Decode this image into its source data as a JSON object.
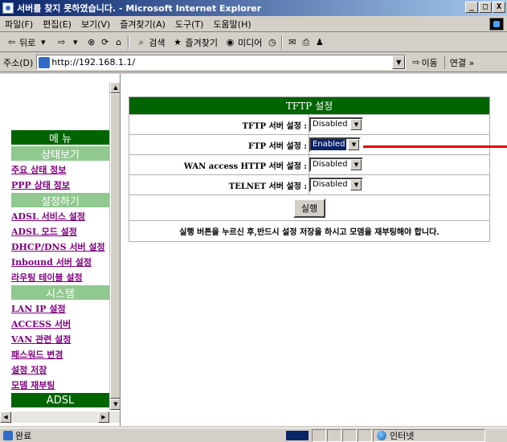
{
  "window": {
    "title": "서버를 찾지 못하였습니다. - Microsoft Internet Explorer",
    "buttons": [
      "_",
      "□",
      "X"
    ]
  },
  "menu": [
    "파일(F)",
    "편집(E)",
    "보기(V)",
    "즐겨찾기(A)",
    "도구(T)",
    "도움말(H)"
  ],
  "toolbar": {
    "back": "뒤로",
    "search": "검색",
    "favorites": "즐겨찾기",
    "media": "미디어"
  },
  "address": {
    "label": "주소(D)",
    "url": "http://192.168.1.1/",
    "go": "이동",
    "links": "연결 »"
  },
  "nav": {
    "menu_header": "메 뉴",
    "status_header": "상태보기",
    "status_items": [
      "주요 상태 정보",
      "PPP 상태 정보"
    ],
    "settings_header": "설정하기",
    "settings_items": [
      "ADSL 서비스 설정",
      "ADSL 모드 설정",
      "DHCP/DNS 서버 설정",
      "Inbound 서버 설정",
      "라우팅 테이블 설정"
    ],
    "system_header": "시스템",
    "system_items": [
      "LAN IP 설정",
      "ACCESS 서버",
      "VAN 관련 설정",
      "패스워드 변경",
      "설정 저장",
      "모뎀 재부팅"
    ],
    "footer": "ADSL"
  },
  "main": {
    "title": "TFTP 설정",
    "rows": [
      {
        "label": "TFTP 서버 설정 :",
        "value": "Disabled"
      },
      {
        "label": "FTP 서버 설정 :",
        "value": "Enabled"
      },
      {
        "label": "WAN access HTTP 서버 설정 :",
        "value": "Disabled"
      },
      {
        "label": "TELNET 서버 설정 :",
        "value": "Disabled"
      }
    ],
    "submit": "실행",
    "notice": "실행 버튼을 누르신 후,반드시 설정 저장을 하시고 모뎀을 재부팅해야 합니다."
  },
  "status": {
    "text": "완료",
    "zone": "인터넷"
  },
  "colors": {
    "nav_dark": "#006400",
    "nav_light": "#90c890",
    "link": "#800080",
    "annotation_arrow": "#e00000"
  }
}
